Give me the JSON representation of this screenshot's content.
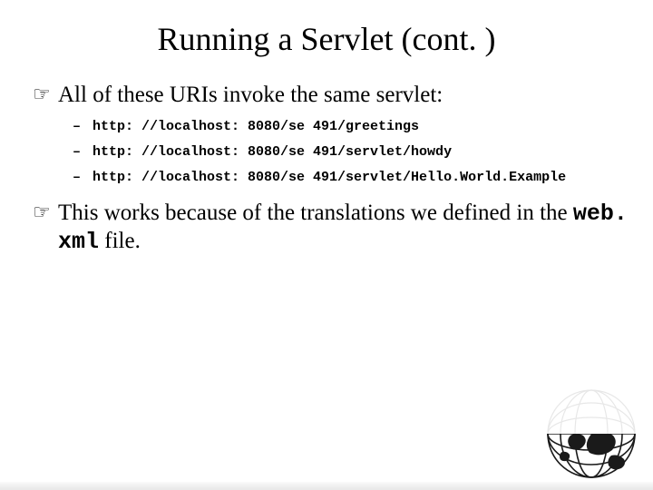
{
  "title": "Running a Servlet (cont. )",
  "point1": "All of these URIs invoke the same servlet:",
  "uris": [
    "http: //localhost: 8080/se 491/greetings",
    "http: //localhost: 8080/se 491/servlet/howdy",
    "http: //localhost: 8080/se 491/servlet/Hello.World.Example"
  ],
  "point2_pre": "This works because of the translations we defined in the ",
  "point2_code": "web. xml",
  "point2_post": " file.",
  "icons": {
    "hand_bullet": "☞",
    "dash": "–"
  }
}
